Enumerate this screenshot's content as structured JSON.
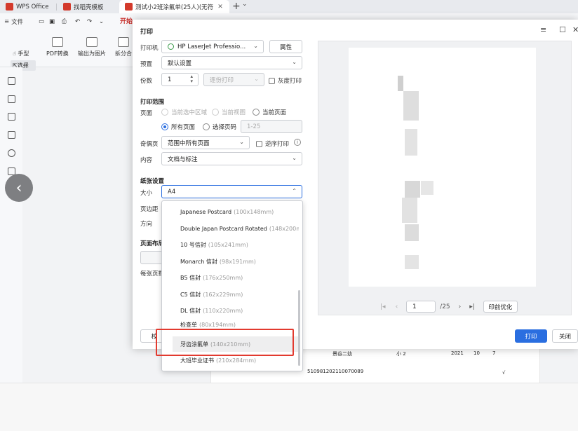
{
  "tabs": [
    {
      "label": "WPS Office",
      "color": "#d33a2c"
    },
    {
      "label": "找稻壳模板",
      "color": "#d33a2c"
    },
    {
      "label": "测试小2班涂氟单(25人)(无符",
      "color": "#d33a2c"
    }
  ],
  "quick_access": {
    "file": "文件"
  },
  "ribbon": {
    "start_tab": "开始"
  },
  "toolbar": {
    "hand": "手型",
    "select": "选择",
    "pdf_convert": "PDF转换",
    "export_image": "输出为图片",
    "split": "拆分合"
  },
  "dialog": {
    "title": "打印",
    "printer_label": "打印机",
    "printer_value": "HP LaserJet Professio...",
    "properties_button": "属性",
    "preset_label": "预置",
    "preset_value": "默认设置",
    "copies_label": "份数",
    "copies_value": "1",
    "collate_value": "逐份打印",
    "grayscale_label": "灰度打印",
    "range_section": "打印范围",
    "pages_label": "页面",
    "range_options": [
      "当前选中区域",
      "当前视图",
      "当前页面",
      "所有页面",
      "选择页码"
    ],
    "page_numbers_placeholder": "1-25",
    "odd_even_label": "奇偶页",
    "odd_even_value": "范围中所有页面",
    "reverse_label": "逆序打印",
    "content_label": "内容",
    "content_value": "文档与标注",
    "paper_section": "纸张设置",
    "size_label": "大小",
    "size_value": "A4",
    "margin_label": "页边距",
    "orientation_label": "方向",
    "layout_section": "页面布局",
    "per_sheet_label": "每张页数",
    "calibrate_button": "校",
    "print_button": "打印",
    "close_button": "关闭"
  },
  "paper_options": [
    {
      "name": "Japanese Postcard",
      "dim": "(100x148mm)"
    },
    {
      "name": "Double Japan Postcard Rotated",
      "dim": "(148x200mm)"
    },
    {
      "name": "10 号信封",
      "dim": "(105x241mm)"
    },
    {
      "name": "Monarch 信封",
      "dim": "(98x191mm)"
    },
    {
      "name": "B5 信封",
      "dim": "(176x250mm)"
    },
    {
      "name": "C5 信封",
      "dim": "(162x229mm)"
    },
    {
      "name": "DL 信封",
      "dim": "(110x220mm)"
    },
    {
      "name": "检查单",
      "dim": "(80x194mm)"
    },
    {
      "name": "牙齿涂氟单",
      "dim": "(140x210mm)"
    },
    {
      "name": "大班毕业证书",
      "dim": "(210x284mm)"
    }
  ],
  "preview": {
    "current_page": "1",
    "total_pages": "/25",
    "optimize_button": "印前优化"
  },
  "doc_texts": {
    "school": "景谷二幼",
    "class": "小 2",
    "year": "2021",
    "n1": "10",
    "n2": "7",
    "id": "510981202110070089",
    "check": "√"
  },
  "colors": {
    "accent": "#2a6ee0",
    "highlight_border": "#e23a2f"
  }
}
